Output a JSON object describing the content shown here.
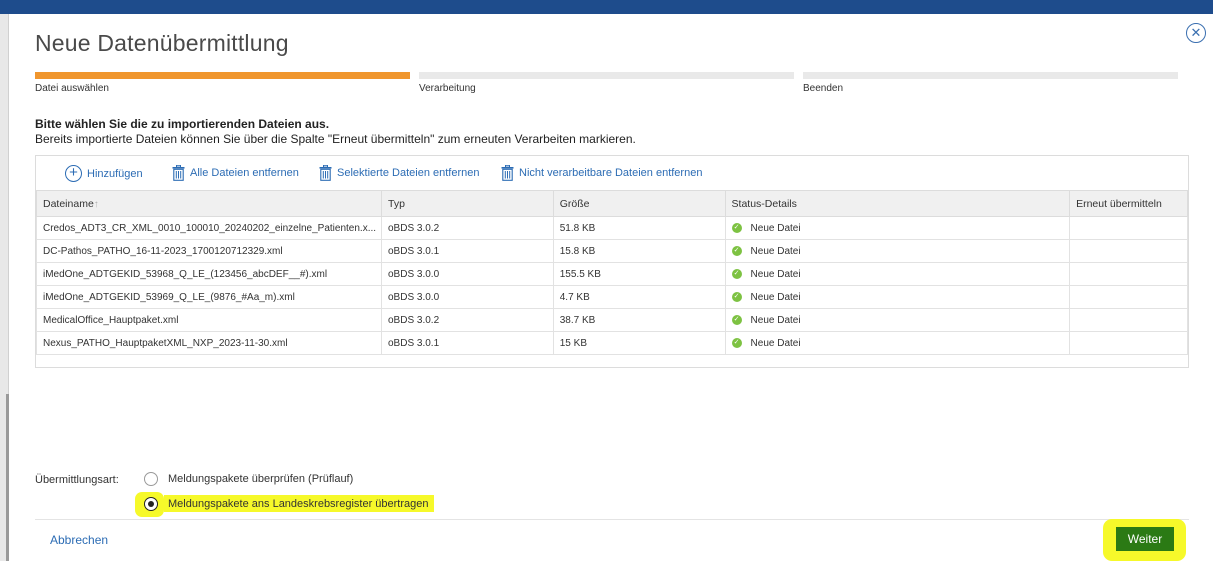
{
  "dialog": {
    "title": "Neue Datenübermittlung",
    "close_icon": "close-circle-icon"
  },
  "steps": [
    {
      "label": "Datei auswählen",
      "active": true
    },
    {
      "label": "Verarbeitung",
      "active": false
    },
    {
      "label": "Beenden",
      "active": false
    }
  ],
  "instructions": {
    "heading": "Bitte wählen Sie die zu importierenden Dateien aus.",
    "sub": "Bereits importierte Dateien können Sie über die Spalte \"Erneut übermitteln\" zum erneuten Verarbeiten markieren."
  },
  "toolbar": {
    "add": "Hinzufügen",
    "remove_all": "Alle Dateien entfernen",
    "remove_selected": "Selektierte Dateien entfernen",
    "remove_unprocessable": "Nicht verarbeitbare Dateien entfernen"
  },
  "table": {
    "headers": {
      "name": "Dateiname",
      "type": "Typ",
      "size": "Größe",
      "status": "Status-Details",
      "resend": "Erneut übermitteln"
    },
    "rows": [
      {
        "name": "Credos_ADT3_CR_XML_0010_100010_20240202_einzelne_Patienten.x...",
        "type": "oBDS 3.0.2",
        "size": "51.8 KB",
        "status": "Neue Datei"
      },
      {
        "name": "DC-Pathos_PATHO_16-11-2023_1700120712329.xml",
        "type": "oBDS 3.0.1",
        "size": "15.8 KB",
        "status": "Neue Datei"
      },
      {
        "name": "iMedOne_ADTGEKID_53968_Q_LE_(123456_abcDEF__#).xml",
        "type": "oBDS 3.0.0",
        "size": "155.5 KB",
        "status": "Neue Datei"
      },
      {
        "name": "iMedOne_ADTGEKID_53969_Q_LE_(9876_#Aa_m).xml",
        "type": "oBDS 3.0.0",
        "size": "4.7 KB",
        "status": "Neue Datei"
      },
      {
        "name": "MedicalOffice_Hauptpaket.xml",
        "type": "oBDS 3.0.2",
        "size": "38.7 KB",
        "status": "Neue Datei"
      },
      {
        "name": "Nexus_PATHO_HauptpaketXML_NXP_2023-11-30.xml",
        "type": "oBDS 3.0.1",
        "size": "15 KB",
        "status": "Neue Datei"
      }
    ]
  },
  "transmission": {
    "label": "Übermittlungsart:",
    "options": [
      {
        "label": "Meldungspakete überprüfen (Prüflauf)",
        "checked": false
      },
      {
        "label": "Meldungspakete ans Landeskrebsregister übertragen",
        "checked": true
      }
    ]
  },
  "footer": {
    "cancel": "Abbrechen",
    "next": "Weiter"
  },
  "colors": {
    "accent_blue": "#2c6cb4",
    "step_active": "#f0962e",
    "status_ok": "#7dc242",
    "next_button": "#2b7a14",
    "highlight": "#f6f92a"
  }
}
